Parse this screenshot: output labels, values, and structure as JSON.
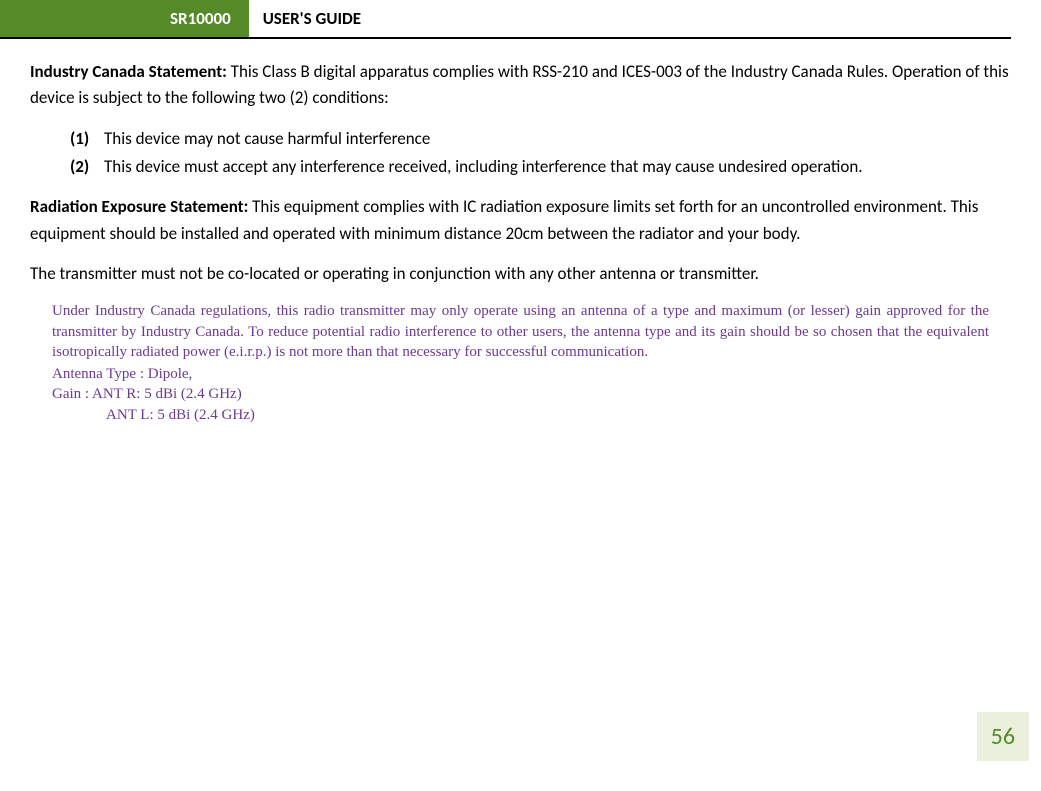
{
  "header": {
    "tab": "SR10000",
    "title": "USER'S GUIDE"
  },
  "industryCanada": {
    "heading": "Industry Canada Statement:",
    "text": " This Class B digital apparatus complies with RSS-210 and ICES-003 of the Industry Canada Rules.  Operation of this device is subject to the following two (2) conditions:"
  },
  "conditions": {
    "item1": {
      "num": "(1)",
      "text": "This device may not cause harmful interference"
    },
    "item2": {
      "num": "(2)",
      "text": "This device must accept any interference received, including interference that may cause undesired operation."
    }
  },
  "radiation": {
    "heading": "Radiation Exposure Statement:",
    "text": " This equipment complies with IC radiation exposure limits set forth for an uncontrolled environment.  This equipment should be installed and operated with minimum distance 20cm between the radiator and your body."
  },
  "transmitter": {
    "text": "The transmitter must not be co-located or operating in conjunction with any other antenna or transmitter."
  },
  "regulatory": {
    "text": "Under Industry Canada regulations, this radio transmitter may only operate using an antenna of a type and maximum (or lesser) gain approved for the transmitter by Industry Canada. To reduce potential radio interference to other users, the antenna type and its gain should be so chosen that the equivalent isotropically radiated power (e.i.r.p.) is not more than that necessary for successful communication.",
    "antennaType": "Antenna Type : Dipole,",
    "gainR": "Gain : ANT R: 5 dBi (2.4 GHz)",
    "gainL": "ANT L: 5 dBi (2.4 GHz)"
  },
  "pageNumber": "56"
}
